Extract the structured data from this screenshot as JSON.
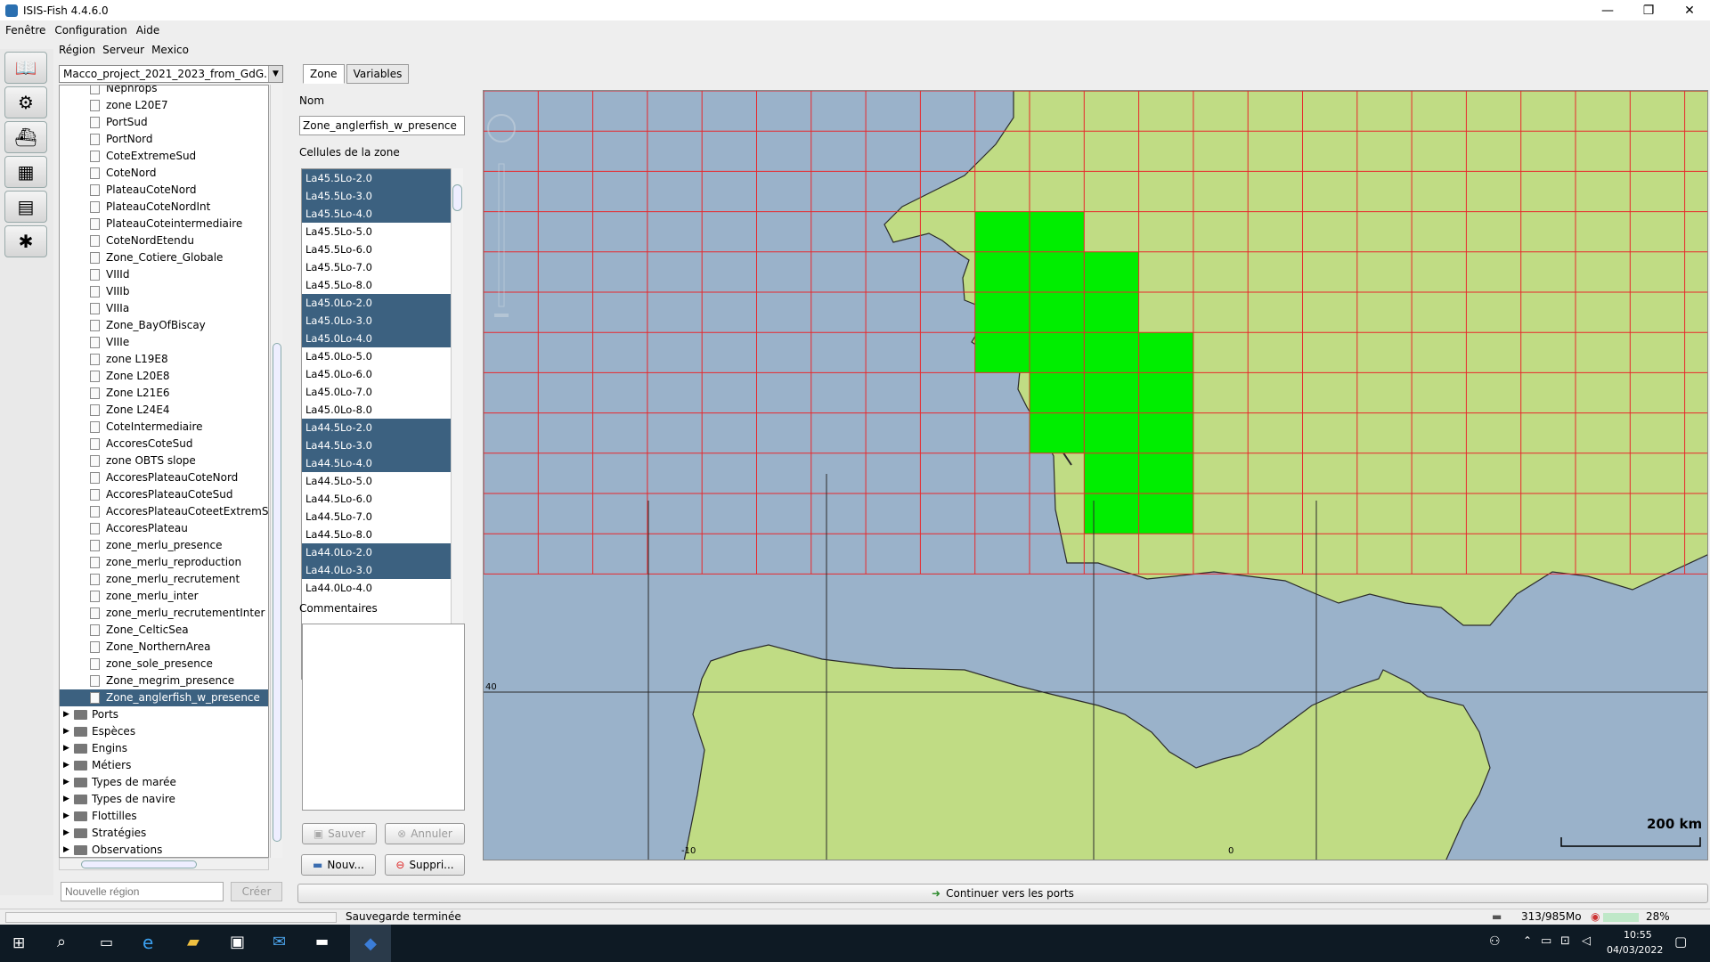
{
  "window": {
    "title": "ISIS-Fish 4.4.6.0",
    "min": "—",
    "max": "❐",
    "close": "✕"
  },
  "menubar": [
    "Fenêtre",
    "Configuration",
    "Aide"
  ],
  "regionmenu": [
    "Région",
    "Serveur",
    "Mexico"
  ],
  "project_combo": "Macco_project_2021_2023_from_GdG...",
  "tree": {
    "leaves": [
      "Nephrops",
      "zone L20E7",
      "PortSud",
      "PortNord",
      "CoteExtremeSud",
      "CoteNord",
      "PlateauCoteNord",
      "PlateauCoteNordInt",
      "PlateauCoteintermediaire",
      "CoteNordEtendu",
      "Zone_Cotiere_Globale",
      "VIIId",
      "VIIIb",
      "VIIIa",
      "Zone_BayOfBiscay",
      "VIIIe",
      "zone L19E8",
      "Zone L20E8",
      "Zone L21E6",
      "Zone L24E4",
      "CoteIntermediaire",
      "AccoresCoteSud",
      "zone OBTS slope",
      "AccoresPlateauCoteNord",
      "AccoresPlateauCoteSud",
      "AccoresPlateauCoteetExtremSud",
      "AccoresPlateau",
      "zone_merlu_presence",
      "zone_merlu_reproduction",
      "zone_merlu_recrutement",
      "zone_merlu_inter",
      "zone_merlu_recrutementInter",
      "Zone_CelticSea",
      "Zone_NorthernArea",
      "zone_sole_presence",
      "Zone_megrim_presence",
      "Zone_anglerfish_w_presence"
    ],
    "selected_leaf": "Zone_anglerfish_w_presence",
    "folders": [
      "Ports",
      "Espèces",
      "Engins",
      "Métiers",
      "Types de marée",
      "Types de navire",
      "Flottilles",
      "Stratégies",
      "Observations"
    ]
  },
  "new_region": {
    "placeholder": "Nouvelle région",
    "create_label": "Créer"
  },
  "tabs": [
    {
      "label": "Zone",
      "active": true
    },
    {
      "label": "Variables",
      "active": false
    }
  ],
  "zone": {
    "name_label": "Nom",
    "name_value": "Zone_anglerfish_w_presence",
    "cells_label": "Cellules de la zone",
    "cells": [
      {
        "name": "La45.5Lo-2.0",
        "selected": true
      },
      {
        "name": "La45.5Lo-3.0",
        "selected": true
      },
      {
        "name": "La45.5Lo-4.0",
        "selected": true
      },
      {
        "name": "La45.5Lo-5.0",
        "selected": false
      },
      {
        "name": "La45.5Lo-6.0",
        "selected": false
      },
      {
        "name": "La45.5Lo-7.0",
        "selected": false
      },
      {
        "name": "La45.5Lo-8.0",
        "selected": false
      },
      {
        "name": "La45.0Lo-2.0",
        "selected": true
      },
      {
        "name": "La45.0Lo-3.0",
        "selected": true
      },
      {
        "name": "La45.0Lo-4.0",
        "selected": true
      },
      {
        "name": "La45.0Lo-5.0",
        "selected": false
      },
      {
        "name": "La45.0Lo-6.0",
        "selected": false
      },
      {
        "name": "La45.0Lo-7.0",
        "selected": false
      },
      {
        "name": "La45.0Lo-8.0",
        "selected": false
      },
      {
        "name": "La44.5Lo-2.0",
        "selected": true
      },
      {
        "name": "La44.5Lo-3.0",
        "selected": true
      },
      {
        "name": "La44.5Lo-4.0",
        "selected": true
      },
      {
        "name": "La44.5Lo-5.0",
        "selected": false
      },
      {
        "name": "La44.5Lo-6.0",
        "selected": false
      },
      {
        "name": "La44.5Lo-7.0",
        "selected": false
      },
      {
        "name": "La44.5Lo-8.0",
        "selected": false
      },
      {
        "name": "La44.0Lo-2.0",
        "selected": true
      },
      {
        "name": "La44.0Lo-3.0",
        "selected": true
      },
      {
        "name": "La44.0Lo-4.0",
        "selected": false
      }
    ],
    "comments_label": "Commentaires",
    "save_label": "Sauver",
    "cancel_label": "Annuler",
    "new_label": "Nouv...",
    "delete_label": "Suppri..."
  },
  "map": {
    "scale_label": "200 km",
    "lat_label": "40",
    "lon_labels": [
      "-10",
      "0"
    ],
    "colors": {
      "sea": "#9ab2ca",
      "land": "#c0dc84",
      "grid": "#e8282c",
      "zone": "#00ee00"
    },
    "zone_cells": [
      {
        "col": 9,
        "row": 3
      },
      {
        "col": 10,
        "row": 3
      },
      {
        "col": 9,
        "row": 4
      },
      {
        "col": 10,
        "row": 4
      },
      {
        "col": 11,
        "row": 4
      },
      {
        "col": 9,
        "row": 5
      },
      {
        "col": 10,
        "row": 5
      },
      {
        "col": 11,
        "row": 5
      },
      {
        "col": 9,
        "row": 6
      },
      {
        "col": 10,
        "row": 6
      },
      {
        "col": 11,
        "row": 6
      },
      {
        "col": 12,
        "row": 6
      },
      {
        "col": 10,
        "row": 7
      },
      {
        "col": 11,
        "row": 7
      },
      {
        "col": 12,
        "row": 7
      },
      {
        "col": 10,
        "row": 8
      },
      {
        "col": 11,
        "row": 8
      },
      {
        "col": 12,
        "row": 8
      },
      {
        "col": 11,
        "row": 9
      },
      {
        "col": 12,
        "row": 9
      },
      {
        "col": 11,
        "row": 10
      },
      {
        "col": 12,
        "row": 10
      }
    ]
  },
  "continue_label": "Continuer vers les ports",
  "status": {
    "message": "Sauvegarde terminée",
    "memory": "313/985Mo",
    "cpu": "28%"
  },
  "taskbar": {
    "time": "10:55",
    "date": "04/03/2022"
  }
}
